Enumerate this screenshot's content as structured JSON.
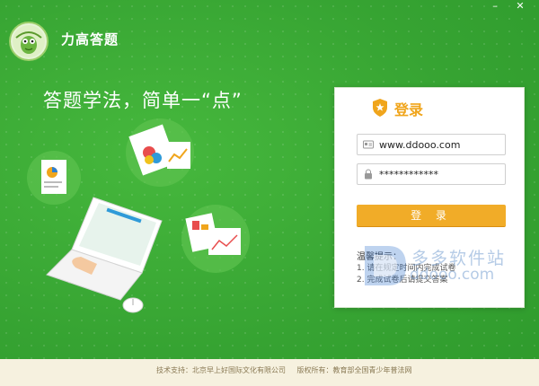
{
  "window": {
    "minimize_glyph": "–",
    "close_glyph": "✕"
  },
  "app": {
    "title": "力高答题",
    "slogan": "答题学法，简单一“点”",
    "accent_green": "#3aaa35",
    "accent_orange": "#f1ac28"
  },
  "login": {
    "title": "登录",
    "username_value": "www.ddooo.com",
    "password_value": "************",
    "button_label": "登 录",
    "tips_title": "温馨提示：",
    "tips": [
      "1. 请在规定时间内完成试卷",
      "2. 完成试卷后请提交答案"
    ]
  },
  "watermark": {
    "cn": "多多软件站",
    "en": "ddooo.com"
  },
  "footer": {
    "support": "技术支持：北京早上好国际文化有限公司",
    "copyright": "版权所有：教育部全国青少年普法网"
  },
  "icons": {
    "user_field": "id-card-icon",
    "password_field": "lock-icon",
    "login_title": "shield-icon"
  }
}
